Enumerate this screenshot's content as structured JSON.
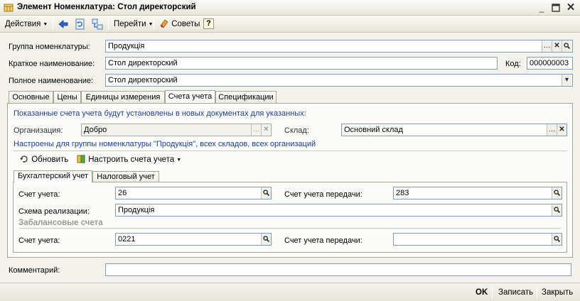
{
  "window": {
    "title": "Элемент Номенклатура: Стол директорский"
  },
  "toolbar": {
    "actions_label": "Действия",
    "goto_label": "Перейти",
    "tips_label": "Советы",
    "help_label": "?"
  },
  "header": {
    "group_label": "Группа номенклатуры:",
    "group_value": "Продукція",
    "short_name_label": "Краткое наименование:",
    "short_name_value": "Стол директорский",
    "code_label": "Код:",
    "code_value": "000000003",
    "full_name_label": "Полное наименование:",
    "full_name_value": "Стол директорский"
  },
  "tabs": [
    {
      "label": "Основные"
    },
    {
      "label": "Цены"
    },
    {
      "label": "Единицы измерения"
    },
    {
      "label": "Счета учета"
    },
    {
      "label": "Спецификации"
    }
  ],
  "accounts": {
    "info_text": "Показанные счета учета будут установлены в новых документах для указанных:",
    "org_label": "Организация:",
    "org_value": "Добро",
    "warehouse_label": "Склад:",
    "warehouse_value": "Основний склад",
    "configured_text": "Настроены для группы номенклатуры \"Продукція\", всех складов, всех организаций",
    "refresh_label": "Обновить",
    "setup_label": "Настроить счета учета",
    "subtabs": [
      {
        "label": "Бухгалтерский учет"
      },
      {
        "label": "Налоговый учет"
      }
    ],
    "account_label": "Счет учета:",
    "account_value": "26",
    "transfer_label": "Счет учета передачи:",
    "transfer_value": "283",
    "scheme_label": "Схема реализации:",
    "scheme_value": "Продукція",
    "offbalance_title": "Забалансовые счета",
    "ob_account_label": "Счет учета:",
    "ob_account_value": "0221",
    "ob_transfer_label": "Счет учета передачи:",
    "ob_transfer_value": ""
  },
  "comment": {
    "label": "Комментарий:",
    "value": ""
  },
  "footer": {
    "ok_label": "OK",
    "write_label": "Записать",
    "close_label": "Закрыть"
  },
  "colors": {
    "accent_blue": "#1c3f95",
    "field_border": "#7f9db9",
    "background": "#f3f2ec"
  }
}
